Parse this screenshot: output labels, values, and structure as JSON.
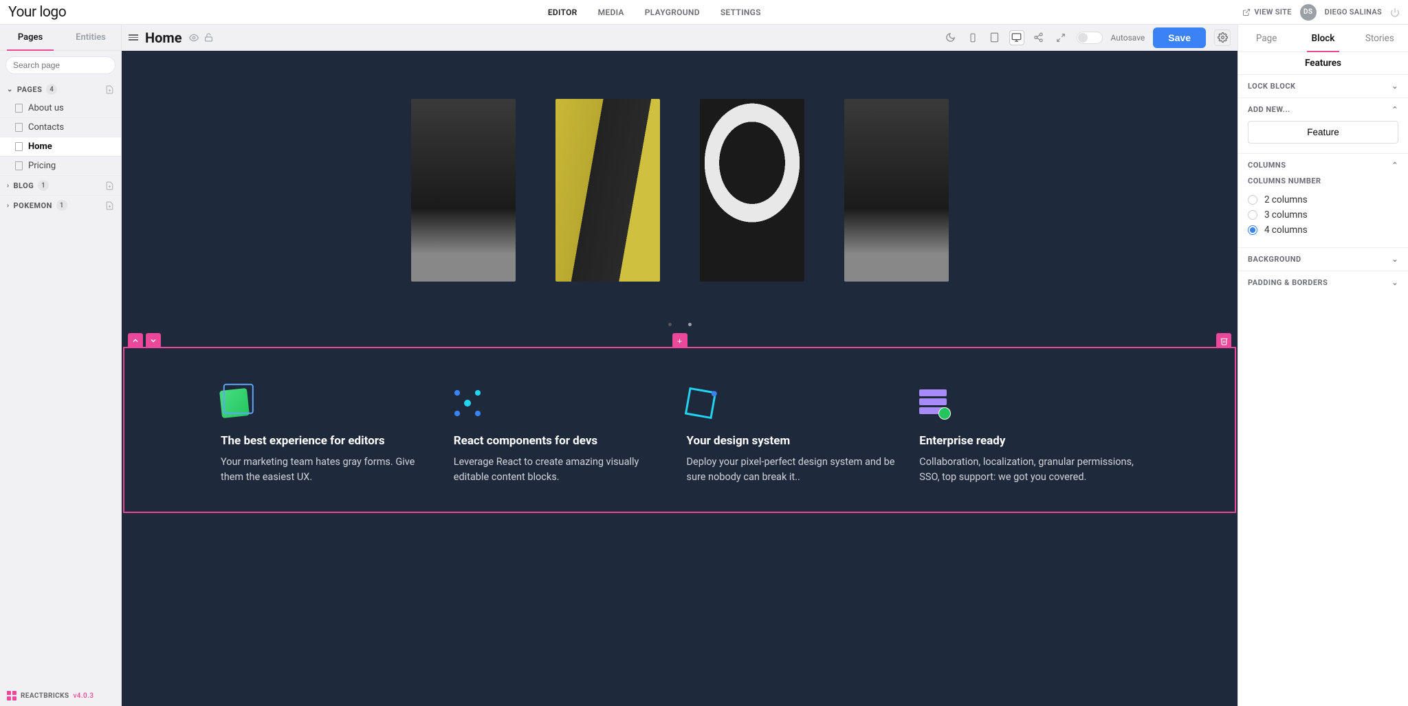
{
  "header": {
    "logo": "Your logo",
    "nav": {
      "editor": "EDITOR",
      "media": "MEDIA",
      "playground": "PLAYGROUND",
      "settings": "SETTINGS"
    },
    "viewsite": "VIEW SITE",
    "avatar_initials": "DS",
    "username": "DIEGO SALINAS"
  },
  "leftTabs": {
    "pages": "Pages",
    "entities": "Entities"
  },
  "search": {
    "placeholder": "Search page"
  },
  "tree": {
    "pages_label": "PAGES",
    "pages_count": "4",
    "items": {
      "about": "About us",
      "contacts": "Contacts",
      "home": "Home",
      "pricing": "Pricing"
    },
    "blog_label": "BLOG",
    "blog_count": "1",
    "pokemon_label": "POKEMON",
    "pokemon_count": "1"
  },
  "footer": {
    "brand": "REACTBRICKS",
    "version": "v4.0.3"
  },
  "canvasbar": {
    "title": "Home",
    "autosave": "Autosave",
    "save": "Save"
  },
  "features": {
    "items": [
      {
        "title": "The best experience for editors",
        "desc": "Your marketing team hates gray forms. Give them the easiest UX."
      },
      {
        "title": "React components for devs",
        "desc": "Leverage React to create amazing visually editable content blocks."
      },
      {
        "title": "Your design system",
        "desc": "Deploy your pixel-perfect design system and be sure nobody can break it.."
      },
      {
        "title": "Enterprise ready",
        "desc": "Collaboration, localization, granular permissions, SSO, top support: we got you covered."
      }
    ]
  },
  "rightTabs": {
    "page": "Page",
    "block": "Block",
    "stories": "Stories"
  },
  "blockTitle": "Features",
  "sections": {
    "lock": "LOCK BLOCK",
    "addnew": "ADD NEW...",
    "addFeature": "Feature",
    "columns": "COLUMNS",
    "colnumLabel": "COLUMNS NUMBER",
    "col2": "2 columns",
    "col3": "3 columns",
    "col4": "4 columns",
    "background": "BACKGROUND",
    "padding": "PADDING & BORDERS"
  }
}
